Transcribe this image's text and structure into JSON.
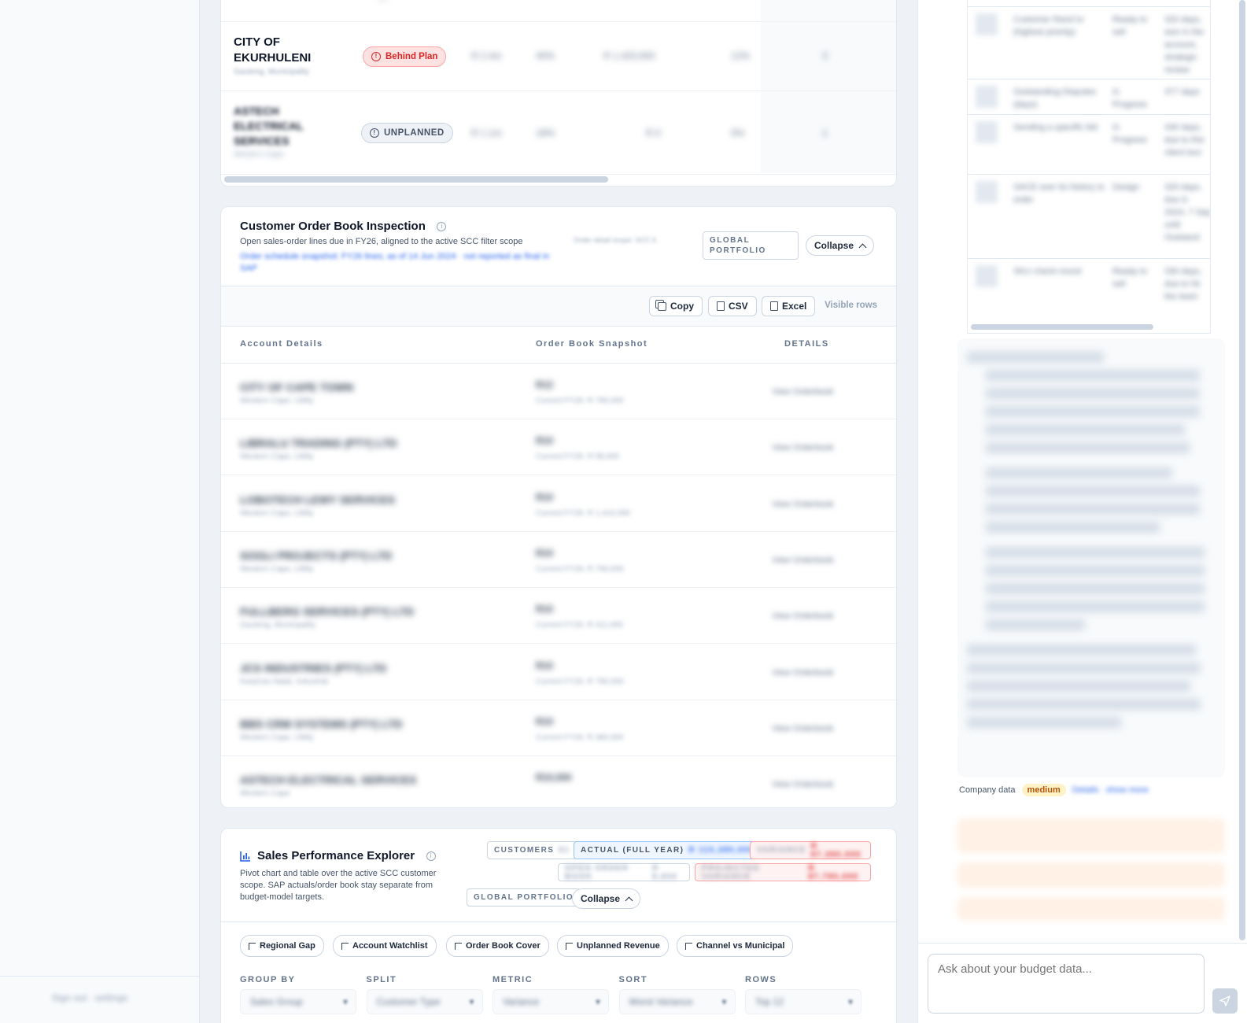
{
  "top_table": {
    "rows": [
      {
        "name": "CITY OF EKURHULENI",
        "sub": "Gauteng, Municipality",
        "status": "Behind Plan",
        "v1": "R 2.4m",
        "v2": "40%",
        "v3": "R 1,420,000",
        "v4": "12%",
        "v5": "3"
      },
      {
        "name": "ASTECH ELECTRICAL SERVICES",
        "sub": "Western Cape",
        "status": "UNPLANNED",
        "v1": "R 1.1m",
        "v2": "18%",
        "v3": "R 0",
        "v4": "0%",
        "v5": "1"
      }
    ]
  },
  "order_book": {
    "title": "Customer Order Book Inspection",
    "subtitle": "Open sales-order lines due in FY26, aligned to the active SCC filter scope",
    "link_text": "Order schedule snapshot: FY26 lines; as of 14 Jun 2024 · not reported as final in SAP",
    "scope_note": "Order detail scope: SCC 5",
    "portfolio_label": "GLOBAL PORTFOLIO",
    "collapse_label": "Collapse",
    "toolbar": {
      "copy": "Copy",
      "csv": "CSV",
      "excel": "Excel",
      "visible_rows": "Visible rows"
    },
    "headers": {
      "account": "Account Details",
      "snapshot": "Order Book Snapshot",
      "details": "DETAILS"
    },
    "rows": [
      {
        "name": "CITY OF CAPE TOWN",
        "sub": "Western Cape, Utility",
        "v1": "R12",
        "v2": "Current FY26: R 790,000",
        "detail": "View Orderbook"
      },
      {
        "name": "LIBRALU TRADING (PTY) LTD",
        "sub": "Western Cape, Utility",
        "v1": "R10",
        "v2": "Current FY26: R 58,000",
        "detail": "View Orderbook"
      },
      {
        "name": "LOBOTECH LEWY SERVICES",
        "sub": "Western Cape, Utility",
        "v1": "R10",
        "v2": "Current FY26: R 1,410,000",
        "detail": "View Orderbook"
      },
      {
        "name": "SOGLI PROJECTS (PTY) LTD",
        "sub": "Western Cape, Utility",
        "v1": "R10",
        "v2": "Current FY26: R 790,000",
        "detail": "View Orderbook"
      },
      {
        "name": "FULLBERG SERVICES (PTY) LTD",
        "sub": "Gauteng, Municipality",
        "v1": "R10",
        "v2": "Current FY26: R 411,000",
        "detail": "View Orderbook"
      },
      {
        "name": "JCS INDUSTRIES (PTY) LTD",
        "sub": "KwaZulu-Natal, Industrial",
        "v1": "R10",
        "v2": "Current FY26: R 790,000",
        "detail": "View Orderbook"
      },
      {
        "name": "BBS CRM SYSTEMS (PTY) LTD",
        "sub": "Western Cape, Utility",
        "v1": "R10",
        "v2": "Current FY26: R 380,000",
        "detail": "View Orderbook"
      },
      {
        "name": "ASTECH ELECTRICAL SERVICES",
        "sub": "Western Cape",
        "v1": "R10,000",
        "v2": "",
        "detail": "View Orderbook"
      }
    ]
  },
  "sales_perf": {
    "title": "Sales Performance Explorer",
    "subtitle": "Pivot chart and table over the active SCC customer scope. SAP actuals/order book stay separate from budget-model targets.",
    "chips": {
      "customers_label": "CUSTOMERS",
      "customers_value": "61",
      "actual_label": "ACTUAL (FULL YEAR)",
      "actual_value": "R 115,380,000",
      "variance_label": "VARIANCE",
      "variance_value": "R 87,380,000",
      "order_label": "OPEN ORDER BOOK",
      "order_value": "R 8,650",
      "projected_label": "PROJECTED VARIANCE",
      "projected_value": "R 87,780,000"
    },
    "portfolio_label": "GLOBAL PORTFOLIO",
    "collapse_label": "Collapse",
    "presets": [
      "Regional Gap",
      "Account Watchlist",
      "Order Book Cover",
      "Unplanned Revenue",
      "Channel vs Municipal"
    ],
    "filters": [
      {
        "label": "GROUP BY",
        "value": "Sales Group"
      },
      {
        "label": "SPLIT",
        "value": "Customer Type"
      },
      {
        "label": "METRIC",
        "value": "Variance"
      },
      {
        "label": "SORT",
        "value": "Worst Variance"
      },
      {
        "label": "ROWS",
        "value": "Top 12"
      }
    ]
  },
  "sidebar": {
    "footer_text": "Sign out · settings"
  },
  "chat": {
    "mini_rows": [
      {
        "c1": "Customer Rand to (highest priority)",
        "c2": "Ready to sell",
        "c3": "320 days, won in the account, strategic review"
      },
      {
        "c1": "Outstanding Disputes (days)",
        "c2": "In Progress",
        "c3": "377 days"
      },
      {
        "c1": "Sending a specific bid",
        "c2": "In Progress",
        "c3": "430 days, due to this client tour"
      },
      {
        "c1": "SACE over its history to order",
        "c2": "Design",
        "c3": "320 days, due in 2024, 7 Sep until Outstand"
      },
      {
        "c1": "SKU check-round",
        "c2": "Ready to sell",
        "c3": "330 days, due to hit the team"
      }
    ],
    "meta_label": "Company data",
    "meta_badge": "medium",
    "meta_link": "Details · show more",
    "input_placeholder": "Ask about your budget data..."
  },
  "colors": {
    "accent": "#2563eb",
    "danger": "#dc2626",
    "warning_bg": "#fef3c7",
    "border": "#e2e8f0"
  }
}
